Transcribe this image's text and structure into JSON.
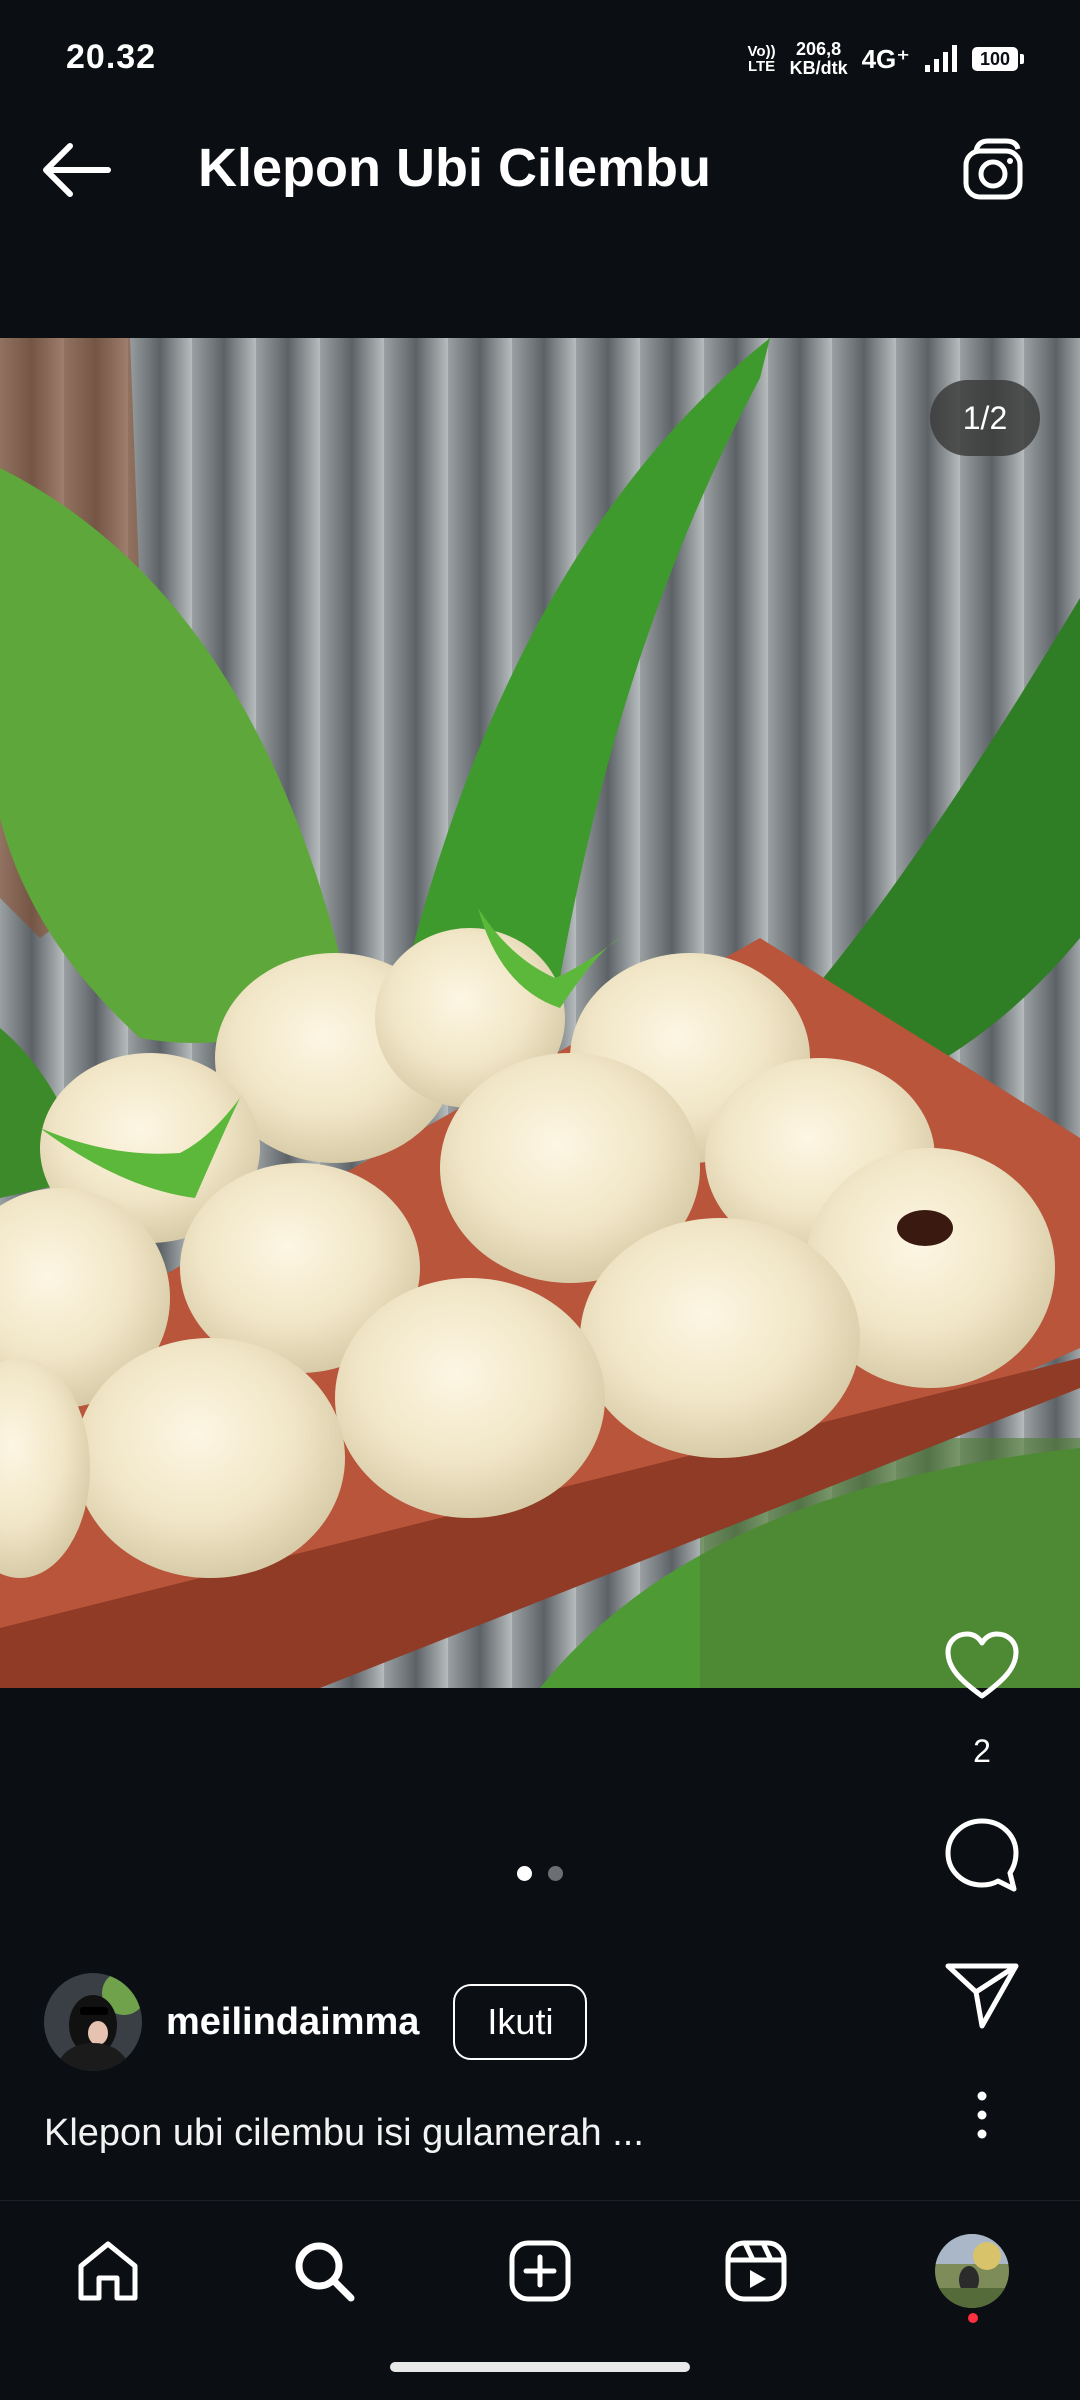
{
  "status_bar": {
    "time": "20.32",
    "volte_top": "Vo))",
    "volte_bottom": "LTE",
    "net_speed_value": "206,8",
    "net_speed_unit": "KB/dtk",
    "network_type": "4G⁺",
    "battery": "100"
  },
  "header": {
    "title": "Klepon Ubi Cilembu",
    "back_icon": "arrow-left-icon",
    "camera_icon": "camera-icon"
  },
  "post": {
    "page_indicator": "1/2",
    "like_count": "2",
    "carousel": {
      "total": 2,
      "active_index": 0
    },
    "username": "meilindaimma",
    "follow_label": "Ikuti",
    "caption": "Klepon ubi cilembu isi gulamerah ..."
  },
  "bottom_nav": {
    "items": [
      "home-icon",
      "search-icon",
      "add-post-icon",
      "reels-icon",
      "profile-avatar"
    ]
  },
  "colors": {
    "background": "#0b0f14",
    "text": "#ffffff",
    "notification_dot": "#ff3040"
  }
}
